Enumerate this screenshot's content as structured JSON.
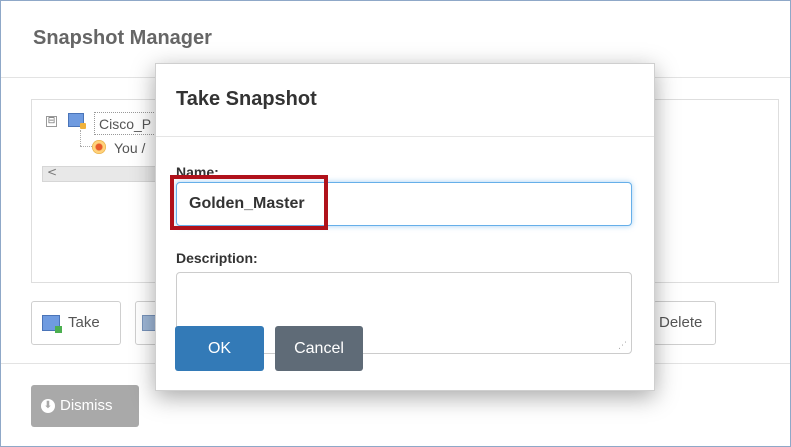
{
  "manager": {
    "title": "Snapshot Manager",
    "tree": {
      "root_label": "Cisco_P",
      "current_label": "You /",
      "collapse_symbol": "⊟",
      "scroll_left_symbol": "<"
    },
    "buttons": {
      "take_label": "Take",
      "delete_label": "Delete",
      "dismiss_label": "Dismiss",
      "dismiss_icon_symbol": "⬇"
    }
  },
  "modal": {
    "title": "Take Snapshot",
    "name_label": "Name:",
    "name_value": "Golden_Master",
    "description_label": "Description:",
    "description_value": "",
    "ok_label": "OK",
    "cancel_label": "Cancel",
    "resize_grip_symbol": "⋰"
  },
  "colors": {
    "primary": "#337ab7",
    "secondary": "#5f6b77",
    "highlight": "#b0121b",
    "dismiss": "#a9a9a9"
  }
}
